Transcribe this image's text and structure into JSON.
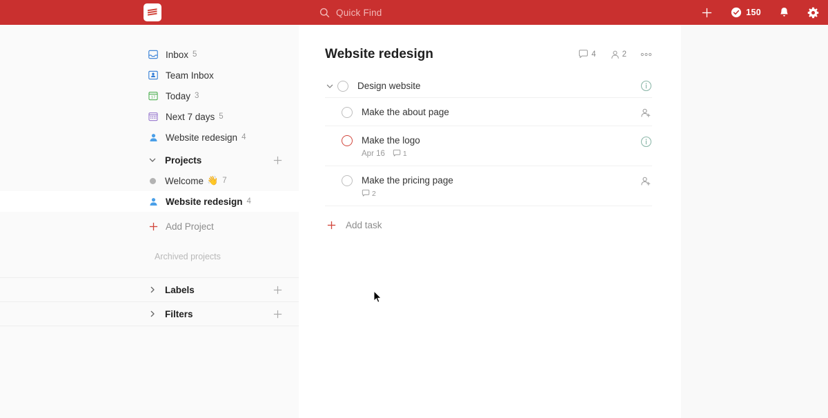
{
  "topbar": {
    "logo": "todoist-logo",
    "quick_find": {
      "label": "Quick Find",
      "icon": "search-icon"
    },
    "add_label": "+",
    "karma": "150",
    "icons": [
      "plus-icon",
      "check-circle-icon",
      "bell-icon",
      "gear-icon"
    ]
  },
  "sidebar": {
    "nav": [
      {
        "label": "Inbox",
        "count": "5",
        "icon": "inbox-icon"
      },
      {
        "label": "Team Inbox",
        "count": "",
        "icon": "team-inbox-icon"
      },
      {
        "label": "Today",
        "count": "3",
        "icon": "today-calendar-icon"
      },
      {
        "label": "Next 7 days",
        "count": "5",
        "icon": "next-7-days-icon"
      },
      {
        "label": "Website redesign",
        "count": "4",
        "icon": "shared-project-icon"
      }
    ],
    "projects": {
      "title": "Projects",
      "add_tooltip": "+",
      "items": [
        {
          "label": "Welcome",
          "emoji": "👋",
          "count": "7",
          "selected": false
        },
        {
          "label": "Website redesign",
          "emoji": "",
          "count": "4",
          "selected": true
        }
      ],
      "add_project_label": "Add Project",
      "archived_label": "Archived projects"
    },
    "labels": {
      "title": "Labels",
      "add_tooltip": "+"
    },
    "filters": {
      "title": "Filters",
      "add_tooltip": "+"
    }
  },
  "main": {
    "title": "Website redesign",
    "comments_count": "4",
    "members_count": "2",
    "more_label": "●●●",
    "parent_task": {
      "title": "Design website",
      "info_icon": "info-icon"
    },
    "subtasks": [
      {
        "title": "Make the about page",
        "due": "",
        "comments": "",
        "priority": "none",
        "action": "add-person-icon"
      },
      {
        "title": "Make the logo",
        "due": "Apr 16",
        "comments": "1",
        "priority": "p1",
        "action": "info-icon"
      },
      {
        "title": "Make the pricing page",
        "due": "",
        "comments": "2",
        "priority": "none",
        "action": "add-person-icon"
      }
    ],
    "add_task_label": "Add task"
  },
  "colors": {
    "brand_red": "#c9302f",
    "accent_red": "#d1453b",
    "info_teal": "#8fb9ab",
    "sidebar_bg": "#fafafa",
    "page_bg": "#f9f9f9"
  }
}
